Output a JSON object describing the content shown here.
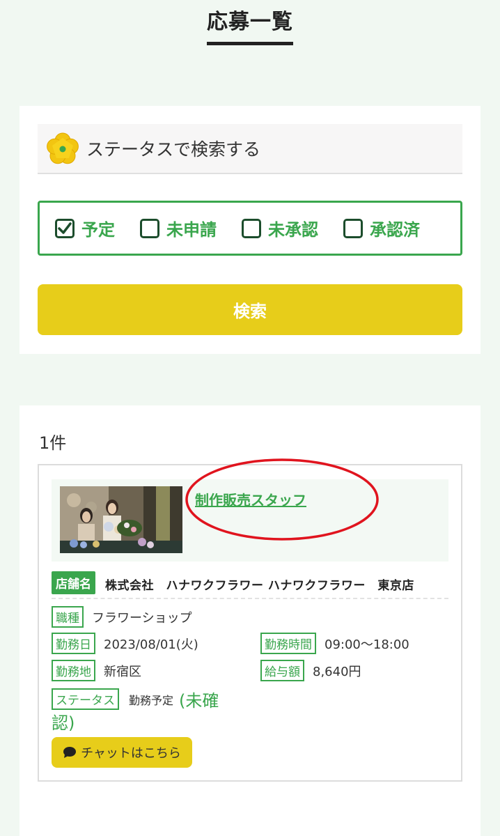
{
  "page": {
    "title": "応募一覧"
  },
  "search": {
    "heading": "ステータスで検索する",
    "statuses": [
      {
        "label": "予定",
        "checked": true
      },
      {
        "label": "未申請",
        "checked": false
      },
      {
        "label": "未承認",
        "checked": false
      },
      {
        "label": "承認済",
        "checked": false
      }
    ],
    "button_label": "検索"
  },
  "results": {
    "count_text": "1件",
    "items": [
      {
        "job_title": "制作販売スタッフ",
        "store_tag": "店舗名",
        "store_name": "株式会社　ハナワクフラワー ハナワクフラワー　東京店",
        "job_type_tag": "職種",
        "job_type": "フラワーショップ",
        "work_date_tag": "勤務日",
        "work_date": "2023/08/01(火)",
        "work_time_tag": "勤務時間",
        "work_time": "09:00〜18:00",
        "location_tag": "勤務地",
        "location": "新宿区",
        "salary_tag": "給与額",
        "salary": "8,640円",
        "status_tag": "ステータス",
        "status_text": "勤務予定",
        "status_detail_line1": "(未確",
        "status_detail_line2": "認)",
        "chat_label": "チャットはこちら"
      }
    ]
  },
  "colors": {
    "accent_green": "#3aa64d",
    "accent_yellow": "#e7cd1a",
    "background": "#f1f8f2",
    "annotation_red": "#e0141e"
  },
  "icons": [
    "flower-icon",
    "checkbox-checked-icon",
    "checkbox-icon",
    "chat-bubble-icon"
  ]
}
